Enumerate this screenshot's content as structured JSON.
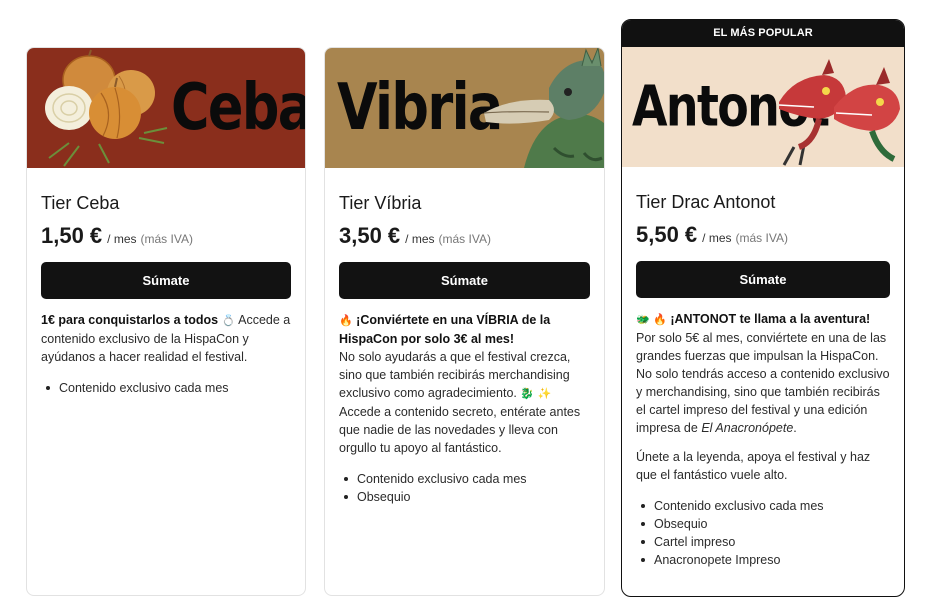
{
  "tiers": [
    {
      "banner_title": "Ceba",
      "banner_color": "#8a2e1c",
      "name": "Tier Ceba",
      "price": "1,50 €",
      "period": "/ mes",
      "vat_note": "(más IVA)",
      "button_label": "Súmate",
      "desc": {
        "bold": "1€ para conquistarlos a todos",
        "emoji": "💍",
        "text": " Accede a contenido exclusivo de la HispaCon y ayúdanos a hacer realidad el festival."
      },
      "benefits": [
        "Contenido exclusivo cada mes"
      ]
    },
    {
      "banner_title": "Vibria",
      "banner_color": "#a8854f",
      "name": "Tier Víbria",
      "price": "3,50 €",
      "period": "/ mes",
      "vat_note": "(más IVA)",
      "button_label": "Súmate",
      "desc": {
        "emoji_lead": "🔥",
        "bold": " ¡Conviértete en una VÍBRIA de la HispaCon por solo 3€ al mes!",
        "text_1": "No solo ayudarás a que el festival crezca, sino que también recibirás merchandising exclusivo como agradecimiento.",
        "emoji_trail": "🐉 ✨",
        "text_2": "Accede a contenido secreto, entérate antes que nadie de las novedades y lleva con orgullo tu apoyo al fantástico."
      },
      "benefits": [
        "Contenido exclusivo cada mes",
        "Obsequio"
      ]
    },
    {
      "badge": "EL MÁS POPULAR",
      "banner_title": "Antonot",
      "banner_color": "#f2dfca",
      "name": "Tier Drac Antonot",
      "price": "5,50 €",
      "period": "/ mes",
      "vat_note": "(más IVA)",
      "button_label": "Súmate",
      "desc": {
        "emoji_lead": "🐲 🔥",
        "bold": " ¡ANTONOT te llama a la aventura!",
        "text_1": "Por solo 5€ al mes, conviértete en una de las grandes fuerzas que impulsan la HispaCon. No solo tendrás acceso a contenido exclusivo y merchandising, sino que también recibirás el cartel impreso del festival y una edición impresa de ",
        "italic": "El Anacronópete",
        "text_1_end": ".",
        "text_2": "Únete a la leyenda, apoya el festival y haz que el fantástico vuele alto."
      },
      "benefits": [
        "Contenido exclusivo cada mes",
        "Obsequio",
        "Cartel impreso",
        "Anacronopete Impreso"
      ]
    }
  ]
}
